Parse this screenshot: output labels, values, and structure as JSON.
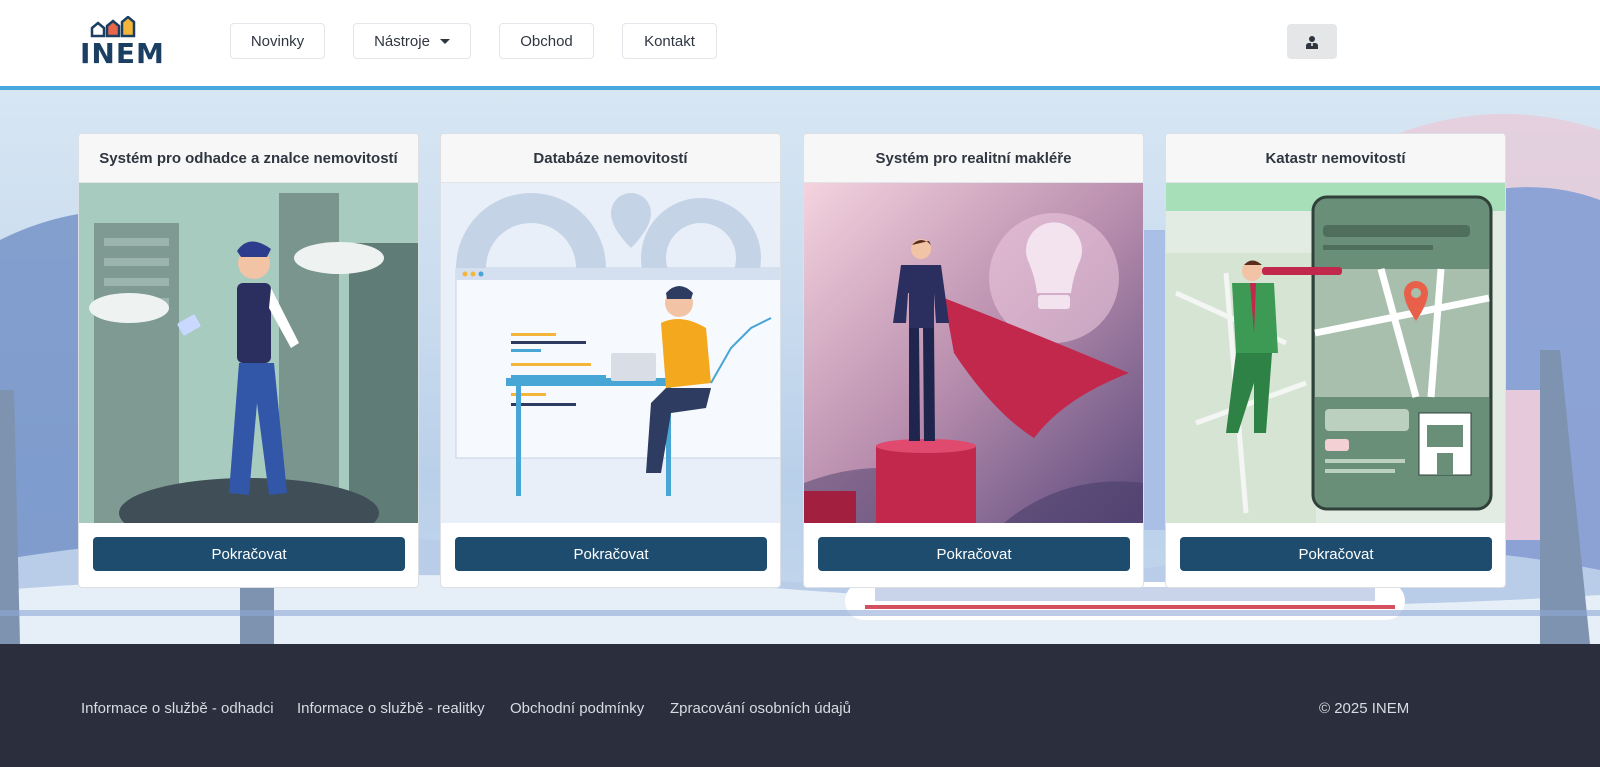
{
  "brand": {
    "logo_text": "INEM"
  },
  "nav": {
    "items": [
      {
        "label": "Novinky"
      },
      {
        "label": "Nástroje"
      },
      {
        "label": "Obchod"
      },
      {
        "label": "Kontakt"
      }
    ]
  },
  "user_icon": "user-icon",
  "cards": [
    {
      "title": "Systém pro odhadce a znalce nemovitostí",
      "button": "Pokračovat"
    },
    {
      "title": "Databáze nemovitostí",
      "button": "Pokračovat"
    },
    {
      "title": "Systém pro realitní makléře",
      "button": "Pokračovat"
    },
    {
      "title": "Katastr nemovitostí",
      "button": "Pokračovat"
    }
  ],
  "footer": {
    "links": [
      "Informace o službě - odhadci",
      "Informace o službě - realitky",
      "Obchodní podmínky",
      "Zpracování osobních údajů"
    ],
    "copyright": "© 2025 INEM"
  },
  "colors": {
    "accent_line": "#4aa8e0",
    "button": "#1d4c6e",
    "footer_bg": "#2b2e3c",
    "logo_text": "#1a3f63"
  }
}
